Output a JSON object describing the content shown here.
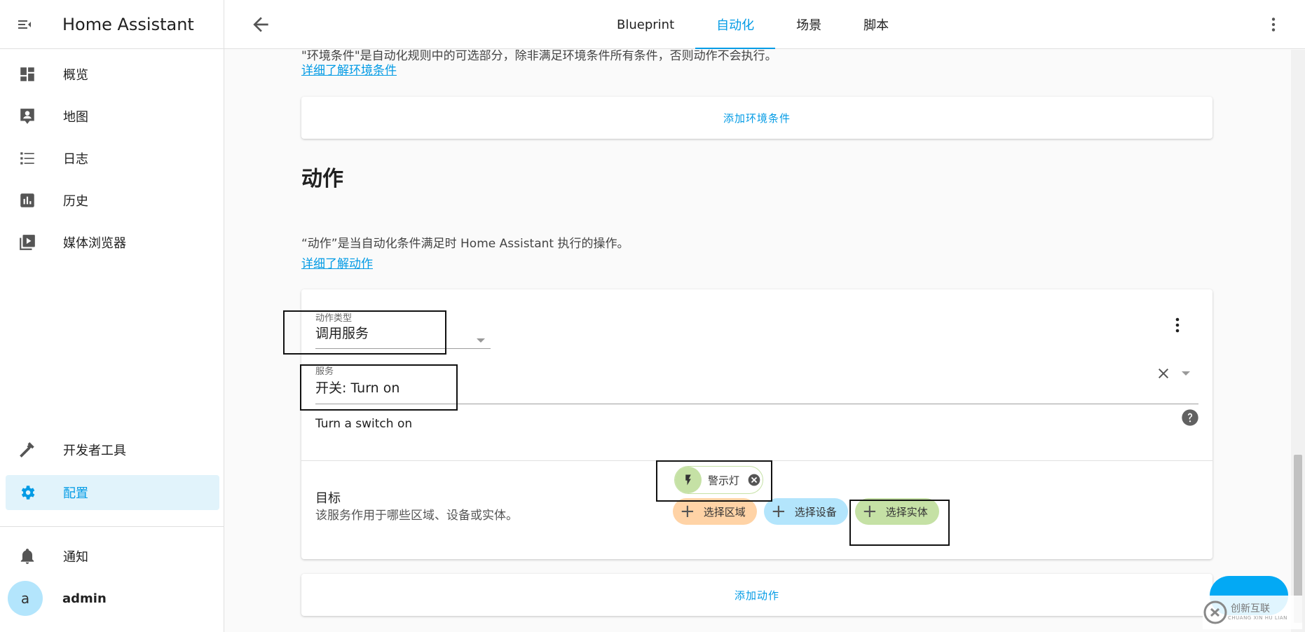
{
  "app": {
    "title": "Home Assistant"
  },
  "sidebar": {
    "items": [
      {
        "label": "概览",
        "icon": "dashboard-icon"
      },
      {
        "label": "地图",
        "icon": "map-account-icon"
      },
      {
        "label": "日志",
        "icon": "format-list-icon"
      },
      {
        "label": "历史",
        "icon": "chart-box-icon"
      },
      {
        "label": "媒体浏览器",
        "icon": "play-box-multiple-icon"
      },
      {
        "label": "开发者工具",
        "icon": "hammer-icon"
      },
      {
        "label": "配置",
        "icon": "cog-icon"
      },
      {
        "label": "通知",
        "icon": "bell-icon"
      }
    ],
    "user": {
      "avatar_letter": "a",
      "name": "admin"
    }
  },
  "topbar": {
    "tabs": [
      {
        "label": "Blueprint"
      },
      {
        "label": "自动化"
      },
      {
        "label": "场景"
      },
      {
        "label": "脚本"
      }
    ],
    "active_tab": "自动化"
  },
  "conditions": {
    "cut_text": "\"环境条件\"是自动化规则中的可选部分，除非满足环境条件所有条件，否则动作不会执行。",
    "learn_more": "详细了解环境条件",
    "add_button": "添加环境条件"
  },
  "actions": {
    "title": "动作",
    "description": "“动作”是当自动化条件满足时 Home Assistant 执行的操作。",
    "learn_more": "详细了解动作",
    "card": {
      "type_label": "动作类型",
      "type_value": "调用服务",
      "service_label": "服务",
      "service_value": "开关: Turn on",
      "service_description": "Turn a switch on",
      "target_title": "目标",
      "target_description": "该服务作用于哪些区域、设备或实体。",
      "selected_entity": "警示灯",
      "chips": [
        {
          "label": "选择区域",
          "color": "#ffd3a6"
        },
        {
          "label": "选择设备",
          "color": "#b3e5fc"
        },
        {
          "label": "选择实体",
          "color": "#c5e1a5"
        }
      ]
    },
    "add_button": "添加动作"
  },
  "watermark": {
    "text": "创新互联",
    "sub": "CHUANG XIN HU LIAN"
  },
  "colors": {
    "accent": "#039be5",
    "active_bg": "#e1f3fb",
    "highlight_box": "#111111"
  }
}
